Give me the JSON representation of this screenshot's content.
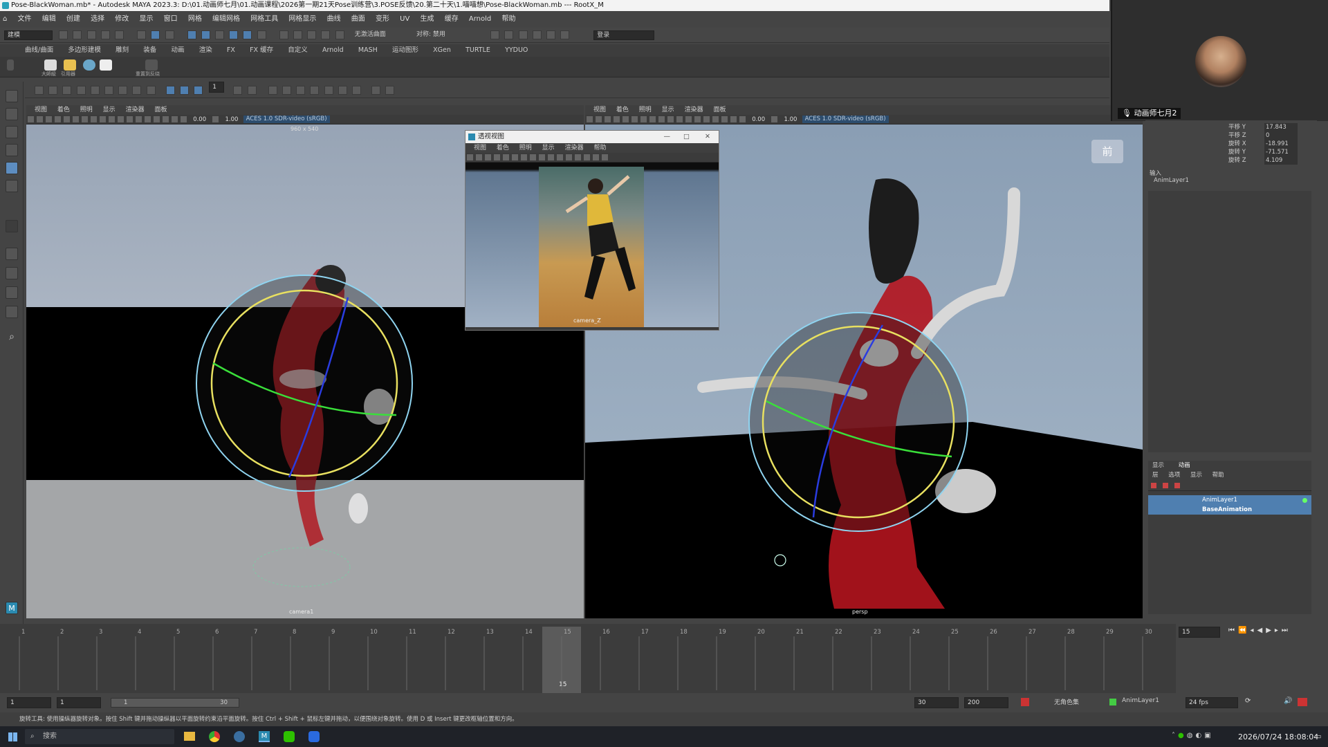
{
  "window": {
    "title": "Pose-BlackWoman.mb* - Autodesk MAYA 2023.3: D:\\01.动画师七月\\01.动画课程\\2026第一期21天Pose训练营\\3.POSE反馈\\20.第二十天\\1.喵喵想\\Pose-BlackWoman.mb  ---  RootX_M"
  },
  "menubar": [
    "文件",
    "编辑",
    "创建",
    "选择",
    "修改",
    "显示",
    "窗口",
    "网格",
    "编辑网格",
    "网格工具",
    "网格显示",
    "曲线",
    "曲面",
    "变形",
    "UV",
    "生成",
    "缓存",
    "Arnold",
    "帮助"
  ],
  "statusline": {
    "mode": "建模",
    "nolive": "无激活曲面",
    "symmetry": "对称: 禁用",
    "login": "登录"
  },
  "shelf_tabs": [
    "曲线/曲面",
    "多边形建模",
    "雕刻",
    "装备",
    "动画",
    "渲染",
    "FX",
    "FX 缓存",
    "自定义",
    "Arnold",
    "MASH",
    "运动图形",
    "XGen",
    "TURTLE",
    "YYDUO"
  ],
  "shelf_labels": [
    "大師級",
    "引用器",
    "重置到反绕"
  ],
  "toolrow": {
    "value": "1"
  },
  "viewport_left": {
    "menu": [
      "视图",
      "着色",
      "照明",
      "显示",
      "渲染器",
      "面板"
    ],
    "val1": "0.00",
    "val2": "1.00",
    "aces": "ACES 1.0 SDR-video (sRGB)",
    "resolution": "960 x 540",
    "camera": "camera1"
  },
  "viewport_right": {
    "menu": [
      "视图",
      "着色",
      "照明",
      "显示",
      "渲染器",
      "面板"
    ],
    "val1": "0.00",
    "val2": "1.00",
    "aces": "ACES 1.0 SDR-video (sRGB)",
    "camera": "persp",
    "viewcube": "前"
  },
  "float_window": {
    "title": "透视视图",
    "menu": [
      "视图",
      "着色",
      "照明",
      "显示",
      "渲染器",
      "帮助"
    ],
    "camera": "camera_Z"
  },
  "channel_box": {
    "rows": [
      {
        "label": "平移 Y",
        "value": "17.843"
      },
      {
        "label": "平移 Z",
        "value": "0"
      },
      {
        "label": "旋转 X",
        "value": "-18.991"
      },
      {
        "label": "旋转 Y",
        "value": "-71.571"
      },
      {
        "label": "旋转 Z",
        "value": "4.109"
      }
    ],
    "inputs_header": "输入",
    "input_item": "AnimLayer1"
  },
  "layer_editor": {
    "tabs": [
      "显示",
      "动画"
    ],
    "menu": [
      "层",
      "选项",
      "显示",
      "帮助"
    ],
    "layers": [
      "AnimLayer1",
      "BaseAnimation"
    ]
  },
  "webcam": {
    "name": "动画师七月2"
  },
  "timeline": {
    "ticks": [
      "1",
      "2",
      "3",
      "4",
      "5",
      "6",
      "7",
      "8",
      "9",
      "10",
      "11",
      "12",
      "13",
      "14",
      "15",
      "16",
      "17",
      "18",
      "19",
      "20",
      "21",
      "22",
      "23",
      "24",
      "25",
      "26",
      "27",
      "28",
      "29",
      "30"
    ],
    "current": "15",
    "current_field": "15"
  },
  "range": {
    "start": "1",
    "start_inner": "1",
    "slider_start": "1",
    "slider_end": "30",
    "end_inner": "30",
    "end": "200",
    "character": "无角色集",
    "layer": "AnimLayer1",
    "fps": "24 fps"
  },
  "helpline": "旋转工具: 使用操纵器旋转对象。按住 Shift 键并拖动操纵器以平面旋转约束沿平面旋转。按住 Ctrl + Shift + 鼠标左键并拖动，以便围绕对象旋转。使用 D 或 Insert 键更改枢轴位置和方向。",
  "taskbar": {
    "search": "搜索",
    "datetime": "2026/07/24 18:08:04"
  },
  "colors": {
    "accent": "#5d8dc0",
    "layer_selected": "#4f7fb0"
  }
}
